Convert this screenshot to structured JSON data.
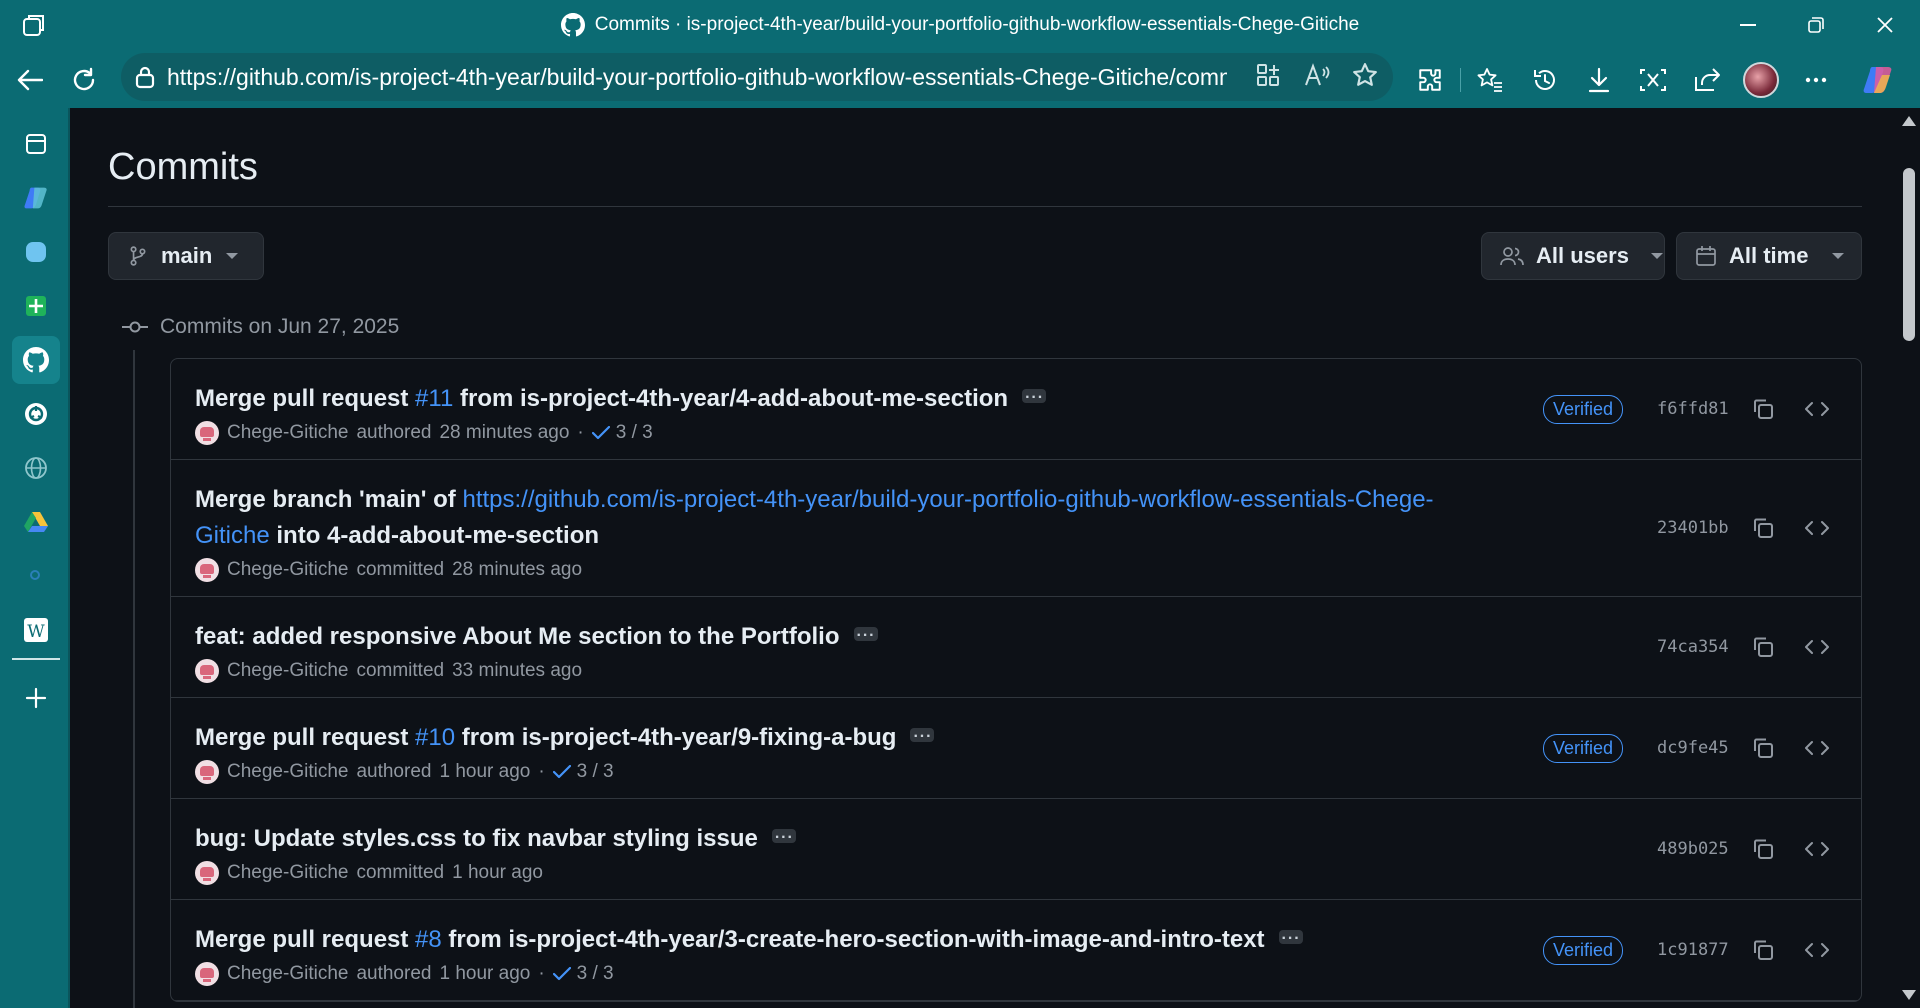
{
  "browser": {
    "window_title": "Commits · is-project-4th-year/build-your-portfolio-github-workflow-essentials-Chege-Gitiche",
    "url": "https://github.com/is-project-4th-year/build-your-portfolio-github-workflow-essentials-Chege-Gitiche/commits/..."
  },
  "page": {
    "title": "Commits",
    "branch_label": "main",
    "users_filter_label": "All users",
    "time_filter_label": "All time",
    "group_header": "Commits on Jun 27, 2025"
  },
  "commits": [
    {
      "msg_prefix": "Merge pull request ",
      "msg_link": "#11",
      "msg_suffix": " from is-project-4th-year/4-add-about-me-section",
      "author": "Chege-Gitiche",
      "action": "authored",
      "time": "28 minutes ago",
      "checks": "3 / 3",
      "verified": "Verified",
      "sha": "f6ffd81"
    },
    {
      "msg_prefix": "Merge branch 'main' of ",
      "msg_link": "https://github.com/is-project-4th-year/build-your-portfolio-github-workflow-essentials-Chege-Gitiche",
      "msg_suffix": " into 4-add-about-me-section",
      "author": "Chege-Gitiche",
      "action": "committed",
      "time": "28 minutes ago",
      "sha": "23401bb"
    },
    {
      "msg_prefix": "feat: added responsive About Me section to the Portfolio",
      "author": "Chege-Gitiche",
      "action": "committed",
      "time": "33 minutes ago",
      "sha": "74ca354"
    },
    {
      "msg_prefix": "Merge pull request ",
      "msg_link": "#10",
      "msg_suffix": " from is-project-4th-year/9-fixing-a-bug",
      "author": "Chege-Gitiche",
      "action": "authored",
      "time": "1 hour ago",
      "checks": "3 / 3",
      "verified": "Verified",
      "sha": "dc9fe45"
    },
    {
      "msg_prefix": "bug: Update styles.css to fix navbar styling issue",
      "author": "Chege-Gitiche",
      "action": "committed",
      "time": "1 hour ago",
      "sha": "489b025"
    },
    {
      "msg_prefix": "Merge pull request ",
      "msg_link": "#8",
      "msg_suffix": " from is-project-4th-year/3-create-hero-section-with-image-and-intro-text",
      "author": "Chege-Gitiche",
      "action": "authored",
      "time": "1 hour ago",
      "checks": "3 / 3",
      "verified": "Verified",
      "sha": "1c91877"
    }
  ],
  "colors": {
    "chrome": "#0b6b73",
    "page_bg": "#0d1117",
    "link": "#4493f8",
    "muted": "#9198a1"
  }
}
